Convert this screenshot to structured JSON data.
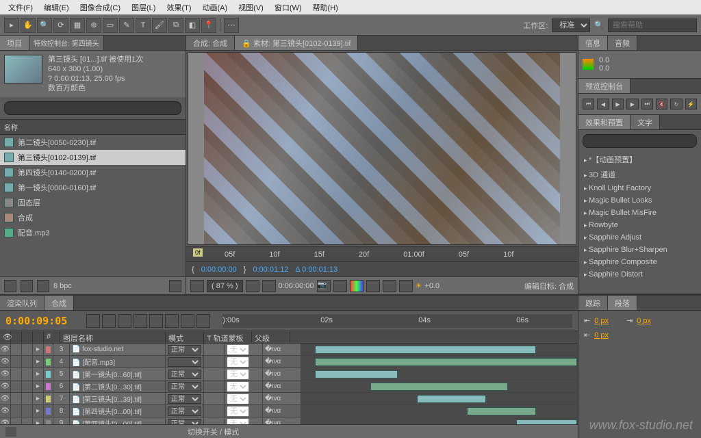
{
  "menu": {
    "file": "文件(F)",
    "edit": "编辑(E)",
    "comp": "图像合成(C)",
    "layer": "图层(L)",
    "effect": "效果(T)",
    "anim": "动画(A)",
    "view": "视图(V)",
    "window": "窗口(W)",
    "help": "帮助(H)"
  },
  "toolbar": {
    "workarea_label": "工作区:",
    "workarea_value": "标准",
    "search_placeholder": "搜索帮助"
  },
  "project": {
    "tab1": "项目",
    "tab2": "特效控制台: 第四镜头",
    "name": "第三镜头 [01...].tif",
    "used": "被使用1次",
    "res": "640 x 300 (1.00)",
    "dur": "? 0:00:01:13, 25.00 fps",
    "colors": "数百万颜色",
    "col_name": "名称",
    "items": [
      {
        "label": "第二镜头[0050-0230].tif",
        "t": "img"
      },
      {
        "label": "第三镜头[0102-0139].tif",
        "t": "img",
        "sel": true
      },
      {
        "label": "第四镜头[0140-0200].tif",
        "t": "img"
      },
      {
        "label": "第一镜头[0000-0160].tif",
        "t": "img"
      },
      {
        "label": "固态层",
        "t": "folder"
      },
      {
        "label": "合成",
        "t": "comp"
      },
      {
        "label": "配音.mp3",
        "t": "audio"
      }
    ],
    "bpc": "8 bpc"
  },
  "viewer": {
    "tab_comp": "合成: 合成",
    "tab_src": "素材: 第三镜头[0102-0139].tif",
    "ruler": [
      "0f",
      "05f",
      "10f",
      "15f",
      "20f",
      "01:00f",
      "05f",
      "10f"
    ],
    "tc1": "0:00:00:00",
    "tc2": "0:00:01:12",
    "tc3": "Δ 0:00:01:13",
    "zoom": "( 87 % )",
    "tcfull": "0:00:00:00",
    "exp": "+0.0",
    "edit_target": "编辑目标: 合成"
  },
  "right": {
    "info_tab": "信息",
    "audio_tab": "音频",
    "v1": "0.0",
    "v2": "0.0",
    "preview_tab": "预览控制台",
    "fx_tab": "效果和预置",
    "text_tab": "文字",
    "fx": [
      "*【动画预置】",
      "3D 通道",
      "Knoll Light Factory",
      "Magic Bullet Looks",
      "Magic Bullet MisFire",
      "Rowbyte",
      "Sapphire Adjust",
      "Sapphire Blur+Sharpen",
      "Sapphire Composite",
      "Sapphire Distort"
    ]
  },
  "timeline": {
    "tab1": "渲染队列",
    "tab2": "合成",
    "tc": "0:00:09:05",
    "ruler": [
      "):00s",
      "02s",
      "04s",
      "06s"
    ],
    "h_idx": "#",
    "h_name": "图层名称",
    "h_mode": "模式",
    "h_trk": "T 轨道蒙板",
    "h_par": "父级",
    "layers": [
      {
        "n": "3",
        "name": "fox-studio.net",
        "mode": "正常",
        "par": "无",
        "clr": "#c77",
        "b": [
          5,
          80
        ]
      },
      {
        "n": "4",
        "name": "[配音.mp3]",
        "mode": "",
        "par": "无",
        "clr": "#7c7",
        "b": [
          5,
          95
        ]
      },
      {
        "n": "5",
        "name": "[第一镜头[0...60].tif]",
        "mode": "正常",
        "par": "无",
        "clr": "#7cc",
        "b": [
          5,
          30
        ]
      },
      {
        "n": "6",
        "name": "[第二镜头[0...30].tif]",
        "mode": "正常",
        "par": "无",
        "clr": "#c7c",
        "b": [
          25,
          50
        ]
      },
      {
        "n": "7",
        "name": "[第三镜头[0...39].tif]",
        "mode": "正常",
        "par": "无",
        "clr": "#cc7",
        "b": [
          42,
          25
        ]
      },
      {
        "n": "8",
        "name": "[第四镜头[0...00].tif]",
        "mode": "正常",
        "par": "无",
        "clr": "#77c",
        "b": [
          60,
          25
        ]
      },
      {
        "n": "9",
        "name": "[第四镜头[0...00].tif]",
        "mode": "正常",
        "par": "无",
        "clr": "#888",
        "b": [
          78,
          22
        ]
      }
    ],
    "ftr": "切换开关 / 模式",
    "track_tab": "跟踪",
    "para_tab": "段落",
    "px": "0 px"
  },
  "watermark": "www.fox-studio.net"
}
